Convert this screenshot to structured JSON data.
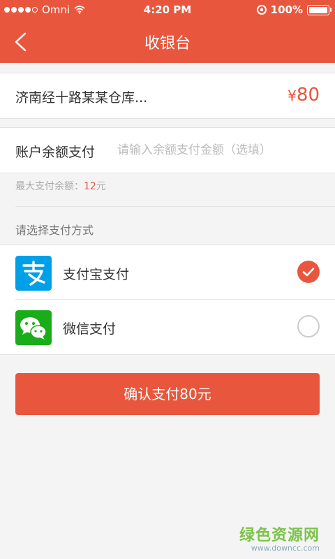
{
  "status_bar": {
    "carrier": "Omni",
    "time": "4:20 PM",
    "battery": "100%",
    "signal_bars": 4,
    "signal_total": 5
  },
  "nav": {
    "back_icon": "chevron-left-icon",
    "title": "收银台"
  },
  "order": {
    "name": "济南经十路某某仓库...",
    "currency": "¥",
    "price": "80"
  },
  "balance": {
    "label": "账户余额支付",
    "placeholder": "请输入余额支付金额（选填）",
    "max_label": "最大支付余额：",
    "max_value": "12",
    "max_unit": "元"
  },
  "payment": {
    "section_title": "请选择支付方式",
    "options": [
      {
        "label": "支付宝支付",
        "icon": "alipay-icon",
        "selected": true
      },
      {
        "label": "微信支付",
        "icon": "wechat-icon",
        "selected": false
      }
    ]
  },
  "confirm": {
    "label": "确认支付80元"
  },
  "watermark": {
    "title": "绿色资源网",
    "url": "www.downcc.com"
  },
  "colors": {
    "accent": "#e8573d",
    "alipay": "#00a0e9",
    "wechat": "#1aad19"
  }
}
